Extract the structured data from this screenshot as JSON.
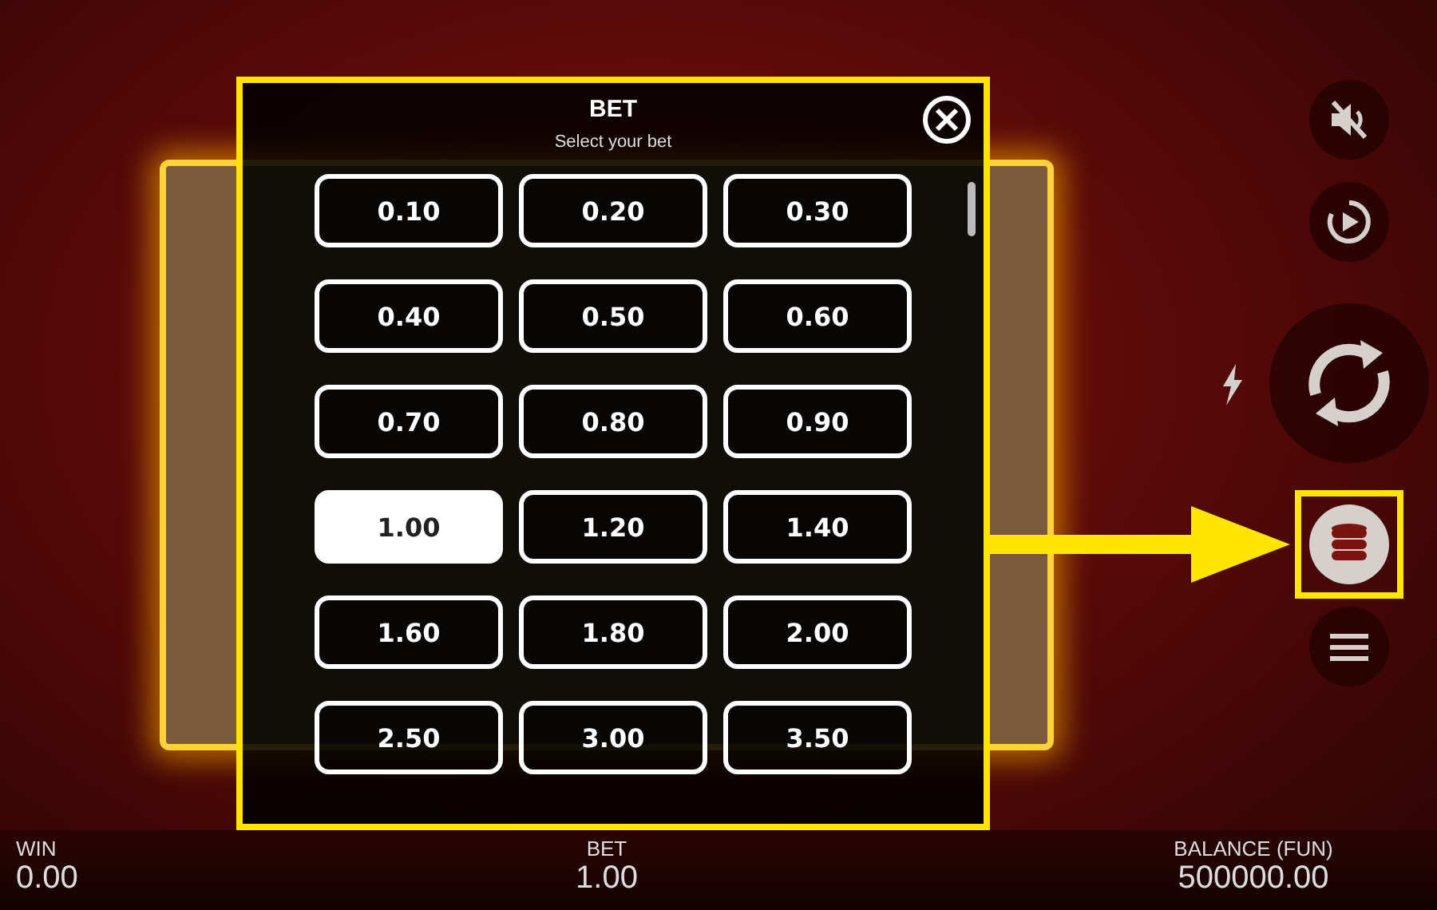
{
  "bet_dialog": {
    "title": "BET",
    "subtitle": "Select your bet",
    "options": [
      {
        "label": "0.10",
        "selected": false
      },
      {
        "label": "0.20",
        "selected": false
      },
      {
        "label": "0.30",
        "selected": false
      },
      {
        "label": "0.40",
        "selected": false
      },
      {
        "label": "0.50",
        "selected": false
      },
      {
        "label": "0.60",
        "selected": false
      },
      {
        "label": "0.70",
        "selected": false
      },
      {
        "label": "0.80",
        "selected": false
      },
      {
        "label": "0.90",
        "selected": false
      },
      {
        "label": "1.00",
        "selected": true
      },
      {
        "label": "1.20",
        "selected": false
      },
      {
        "label": "1.40",
        "selected": false
      },
      {
        "label": "1.60",
        "selected": false
      },
      {
        "label": "1.80",
        "selected": false
      },
      {
        "label": "2.00",
        "selected": false
      },
      {
        "label": "2.50",
        "selected": false
      },
      {
        "label": "3.00",
        "selected": false
      },
      {
        "label": "3.50",
        "selected": false
      }
    ]
  },
  "controls": [
    {
      "kind": "sound",
      "muted": true,
      "highlighted": false
    },
    {
      "kind": "autoplay",
      "highlighted": false
    },
    {
      "kind": "spin",
      "highlighted": false
    },
    {
      "kind": "bet",
      "highlighted": true
    },
    {
      "kind": "menu",
      "highlighted": false
    }
  ],
  "footer": [
    {
      "label": "WIN",
      "value": "0.00"
    },
    {
      "label": "BET",
      "value": "1.00"
    },
    {
      "label": "BALANCE (FUN)",
      "value": "500000.00"
    }
  ]
}
